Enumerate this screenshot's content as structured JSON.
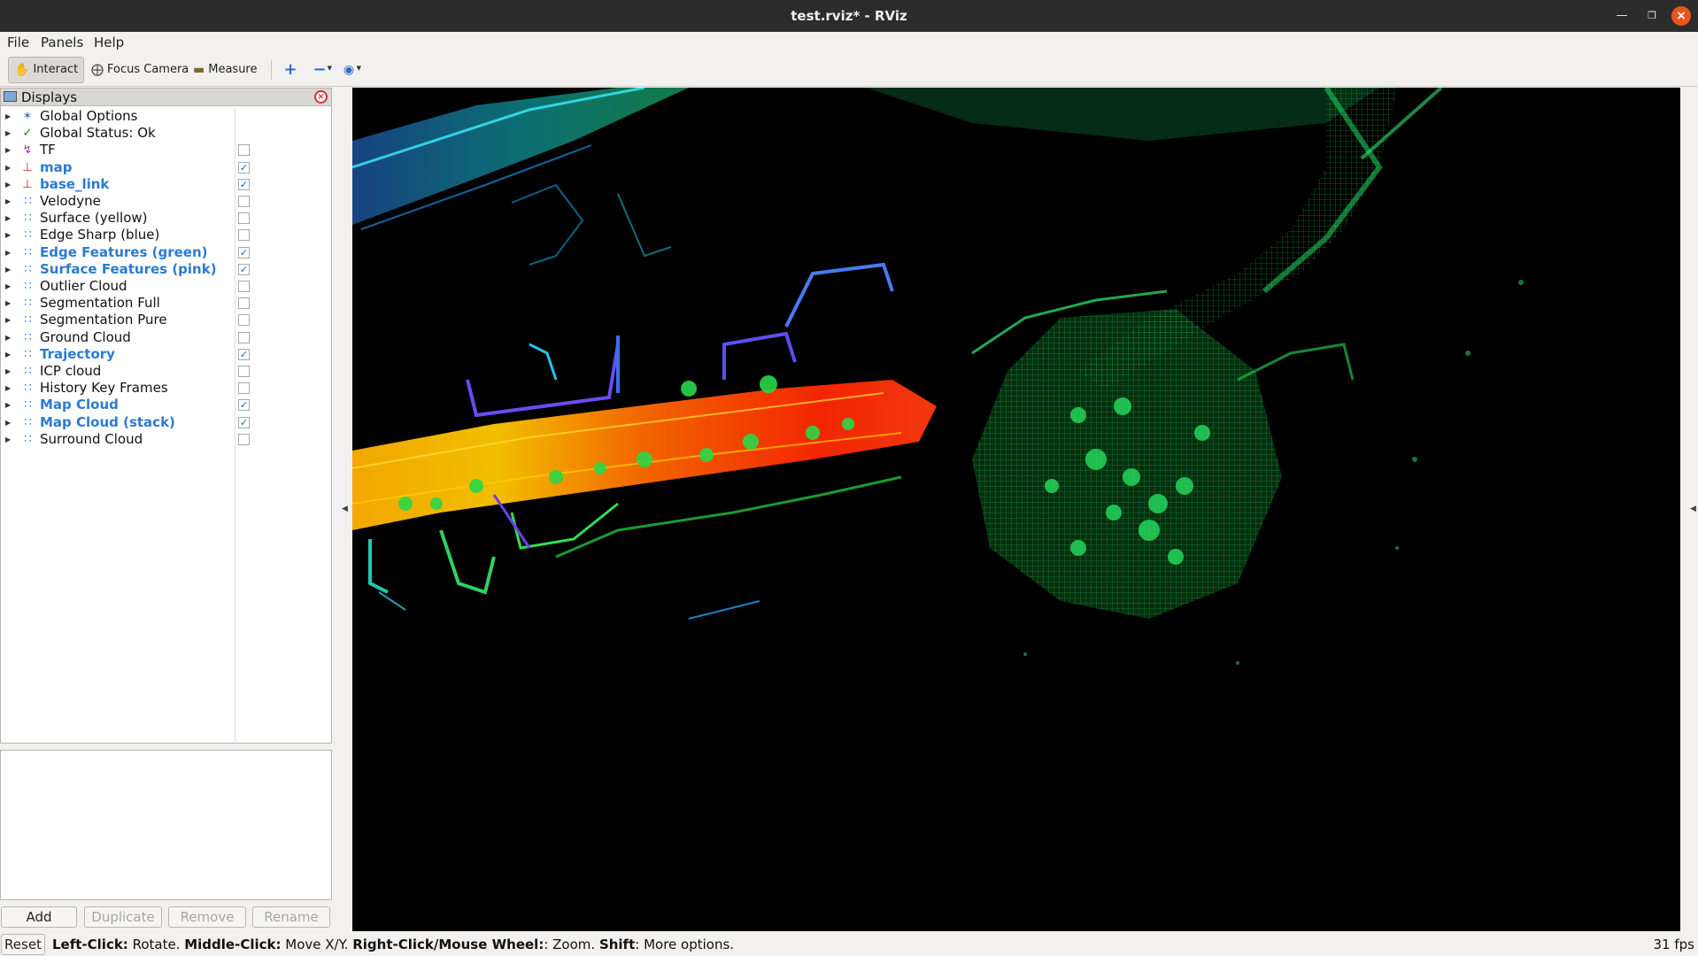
{
  "window": {
    "title": "test.rviz* - RViz"
  },
  "menu": {
    "file": "File",
    "panels": "Panels",
    "help": "Help"
  },
  "toolbar": {
    "interact": "Interact",
    "focus_camera": "Focus Camera",
    "measure": "Measure"
  },
  "displays_panel": {
    "title": "Displays",
    "items": [
      {
        "label": "Global Options",
        "icon": "gear-icon",
        "checkbox": null,
        "enabled": false
      },
      {
        "label": "Global Status: Ok",
        "icon": "checkmark-icon",
        "checkbox": null,
        "enabled": false
      },
      {
        "label": "TF",
        "icon": "tf-icon",
        "checkbox": false,
        "enabled": false
      },
      {
        "label": "map",
        "icon": "axes-icon",
        "checkbox": true,
        "enabled": true
      },
      {
        "label": "base_link",
        "icon": "axes-icon",
        "checkbox": true,
        "enabled": true
      },
      {
        "label": "Velodyne",
        "icon": "pointcloud-icon",
        "checkbox": false,
        "enabled": false
      },
      {
        "label": "Surface (yellow)",
        "icon": "pointcloud-icon",
        "checkbox": false,
        "enabled": false
      },
      {
        "label": "Edge Sharp (blue)",
        "icon": "pointcloud-icon",
        "checkbox": false,
        "enabled": false
      },
      {
        "label": "Edge Features (green)",
        "icon": "pointcloud-icon",
        "checkbox": true,
        "enabled": true
      },
      {
        "label": "Surface Features (pink)",
        "icon": "pointcloud-icon",
        "checkbox": true,
        "enabled": true
      },
      {
        "label": "Outlier Cloud",
        "icon": "pointcloud-icon",
        "checkbox": false,
        "enabled": false
      },
      {
        "label": "Segmentation Full",
        "icon": "pointcloud-icon",
        "checkbox": false,
        "enabled": false
      },
      {
        "label": "Segmentation Pure",
        "icon": "pointcloud-icon",
        "checkbox": false,
        "enabled": false
      },
      {
        "label": "Ground Cloud",
        "icon": "pointcloud-icon",
        "checkbox": false,
        "enabled": false
      },
      {
        "label": "Trajectory",
        "icon": "pointcloud-icon",
        "checkbox": true,
        "enabled": true
      },
      {
        "label": "ICP cloud",
        "icon": "pointcloud-icon",
        "checkbox": false,
        "enabled": false
      },
      {
        "label": "History Key Frames",
        "icon": "pointcloud-icon",
        "checkbox": false,
        "enabled": false
      },
      {
        "label": "Map Cloud",
        "icon": "pointcloud-icon",
        "checkbox": true,
        "enabled": true
      },
      {
        "label": "Map Cloud (stack)",
        "icon": "pointcloud-icon",
        "checkbox": true,
        "enabled": true
      },
      {
        "label": "Surround Cloud",
        "icon": "pointcloud-icon",
        "checkbox": false,
        "enabled": false
      }
    ]
  },
  "buttons": {
    "add": "Add",
    "duplicate": "Duplicate",
    "remove": "Remove",
    "rename": "Rename"
  },
  "status": {
    "reset": "Reset",
    "hint_left_click": "Left-Click:",
    "hint_rotate": " Rotate. ",
    "hint_middle_click": "Middle-Click:",
    "hint_move": " Move X/Y. ",
    "hint_right_click": "Right-Click/Mouse Wheel:",
    "hint_zoom": ": Zoom. ",
    "hint_shift": "Shift",
    "hint_more": ": More options.",
    "fps": "31 fps"
  },
  "colors": {
    "accent": "#2b7bd0",
    "title_bar": "#2c2c2c",
    "close_button": "#e95420",
    "view_background": "#000000"
  }
}
